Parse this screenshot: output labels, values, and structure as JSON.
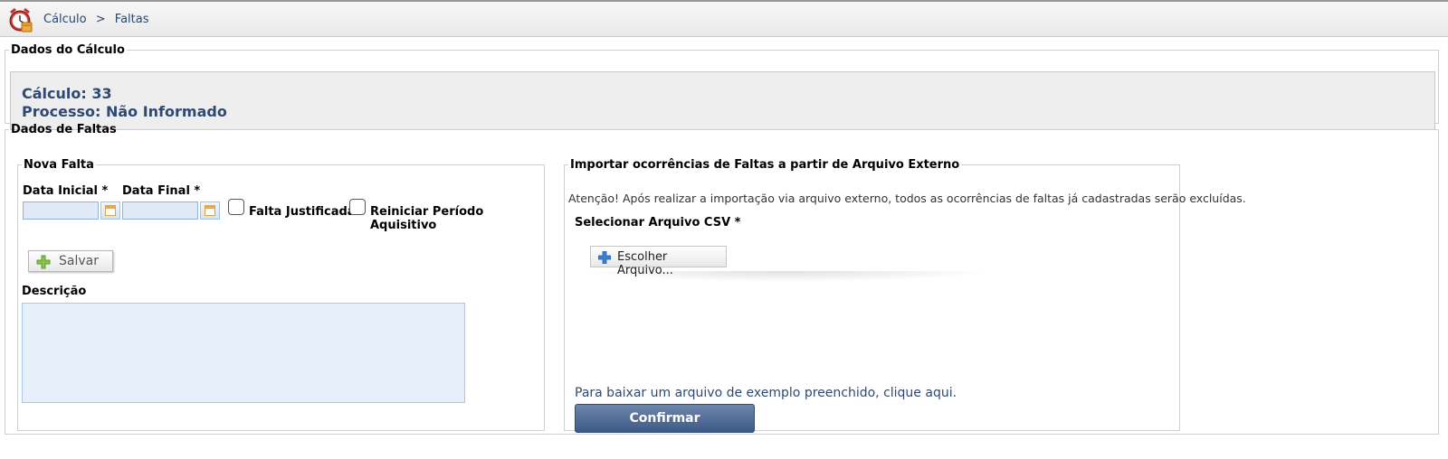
{
  "breadcrumb": {
    "items": [
      "Cálculo",
      "Faltas"
    ],
    "separator": ">"
  },
  "dados_calculo": {
    "legend": "Dados do Cálculo",
    "calculo": "Cálculo: 33",
    "processo": "Processo: Não Informado"
  },
  "dados_faltas": {
    "legend": "Dados de Faltas",
    "nova_falta": {
      "legend": "Nova Falta",
      "data_inicial_label": "Data Inicial *",
      "data_final_label": "Data Final *",
      "data_inicial_value": "",
      "data_final_value": "",
      "falta_justificada_label": "Falta Justificada",
      "reiniciar_label": "Reiniciar Período Aquisitivo",
      "salvar_label": "Salvar",
      "descricao_label": "Descrição",
      "descricao_value": ""
    },
    "importar": {
      "legend": "Importar ocorrências de Faltas a partir de Arquivo Externo",
      "warning": "Atenção! Após realizar a importação via arquivo externo, todos as ocorrências de faltas já cadastradas serão excluídas.",
      "csv_label": "Selecionar Arquivo CSV *",
      "choose_file_label": "Escolher Arquivo...",
      "example_link": "Para baixar um arquivo de exemplo preenchido, clique aqui.",
      "confirmar_label": "Confirmar"
    }
  },
  "icons": {
    "app": "alarm-clock-icon",
    "calendar": "calendar-icon",
    "add_green": "plus-icon",
    "add_blue": "plus-icon"
  },
  "colors": {
    "accent": "#2e4a74",
    "button_primary": "#4d6894",
    "input_bg": "#dfeaf6"
  }
}
